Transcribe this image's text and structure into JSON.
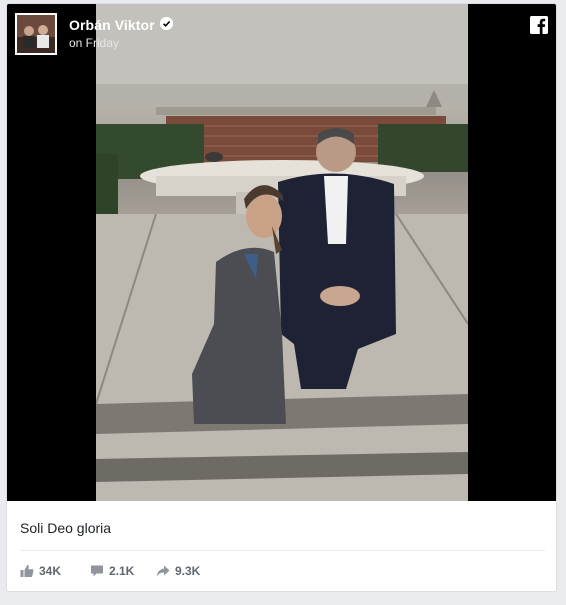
{
  "post": {
    "author": "Orbán Viktor",
    "time": "on Friday",
    "caption": "Soli Deo gloria"
  },
  "stats": {
    "likes": "34K",
    "comments": "2.1K",
    "shares": "9.3K"
  },
  "icons": {
    "verified": "verified-badge-icon",
    "brand": "facebook-icon",
    "like": "like-icon",
    "comment": "comment-icon",
    "share": "share-icon"
  },
  "colors": {
    "background": "#e9ebee",
    "text": "#1d2129",
    "stat_text": "#616770"
  }
}
